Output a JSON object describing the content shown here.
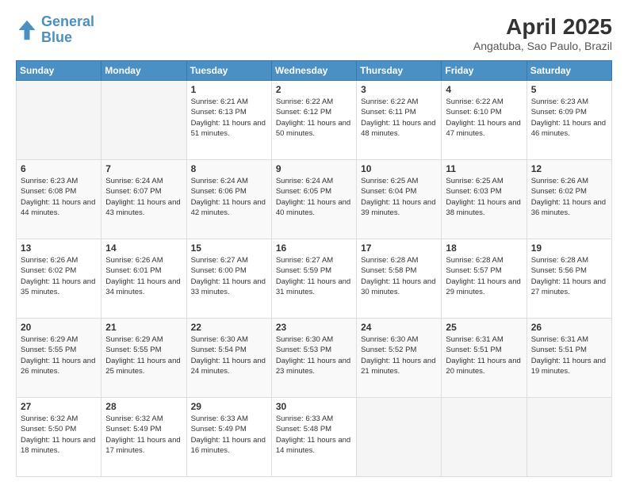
{
  "header": {
    "logo_line1": "General",
    "logo_line2": "Blue",
    "title": "April 2025",
    "subtitle": "Angatuba, Sao Paulo, Brazil"
  },
  "weekdays": [
    "Sunday",
    "Monday",
    "Tuesday",
    "Wednesday",
    "Thursday",
    "Friday",
    "Saturday"
  ],
  "weeks": [
    [
      {
        "day": "",
        "info": ""
      },
      {
        "day": "",
        "info": ""
      },
      {
        "day": "1",
        "info": "Sunrise: 6:21 AM\nSunset: 6:13 PM\nDaylight: 11 hours and 51 minutes."
      },
      {
        "day": "2",
        "info": "Sunrise: 6:22 AM\nSunset: 6:12 PM\nDaylight: 11 hours and 50 minutes."
      },
      {
        "day": "3",
        "info": "Sunrise: 6:22 AM\nSunset: 6:11 PM\nDaylight: 11 hours and 48 minutes."
      },
      {
        "day": "4",
        "info": "Sunrise: 6:22 AM\nSunset: 6:10 PM\nDaylight: 11 hours and 47 minutes."
      },
      {
        "day": "5",
        "info": "Sunrise: 6:23 AM\nSunset: 6:09 PM\nDaylight: 11 hours and 46 minutes."
      }
    ],
    [
      {
        "day": "6",
        "info": "Sunrise: 6:23 AM\nSunset: 6:08 PM\nDaylight: 11 hours and 44 minutes."
      },
      {
        "day": "7",
        "info": "Sunrise: 6:24 AM\nSunset: 6:07 PM\nDaylight: 11 hours and 43 minutes."
      },
      {
        "day": "8",
        "info": "Sunrise: 6:24 AM\nSunset: 6:06 PM\nDaylight: 11 hours and 42 minutes."
      },
      {
        "day": "9",
        "info": "Sunrise: 6:24 AM\nSunset: 6:05 PM\nDaylight: 11 hours and 40 minutes."
      },
      {
        "day": "10",
        "info": "Sunrise: 6:25 AM\nSunset: 6:04 PM\nDaylight: 11 hours and 39 minutes."
      },
      {
        "day": "11",
        "info": "Sunrise: 6:25 AM\nSunset: 6:03 PM\nDaylight: 11 hours and 38 minutes."
      },
      {
        "day": "12",
        "info": "Sunrise: 6:26 AM\nSunset: 6:02 PM\nDaylight: 11 hours and 36 minutes."
      }
    ],
    [
      {
        "day": "13",
        "info": "Sunrise: 6:26 AM\nSunset: 6:02 PM\nDaylight: 11 hours and 35 minutes."
      },
      {
        "day": "14",
        "info": "Sunrise: 6:26 AM\nSunset: 6:01 PM\nDaylight: 11 hours and 34 minutes."
      },
      {
        "day": "15",
        "info": "Sunrise: 6:27 AM\nSunset: 6:00 PM\nDaylight: 11 hours and 33 minutes."
      },
      {
        "day": "16",
        "info": "Sunrise: 6:27 AM\nSunset: 5:59 PM\nDaylight: 11 hours and 31 minutes."
      },
      {
        "day": "17",
        "info": "Sunrise: 6:28 AM\nSunset: 5:58 PM\nDaylight: 11 hours and 30 minutes."
      },
      {
        "day": "18",
        "info": "Sunrise: 6:28 AM\nSunset: 5:57 PM\nDaylight: 11 hours and 29 minutes."
      },
      {
        "day": "19",
        "info": "Sunrise: 6:28 AM\nSunset: 5:56 PM\nDaylight: 11 hours and 27 minutes."
      }
    ],
    [
      {
        "day": "20",
        "info": "Sunrise: 6:29 AM\nSunset: 5:55 PM\nDaylight: 11 hours and 26 minutes."
      },
      {
        "day": "21",
        "info": "Sunrise: 6:29 AM\nSunset: 5:55 PM\nDaylight: 11 hours and 25 minutes."
      },
      {
        "day": "22",
        "info": "Sunrise: 6:30 AM\nSunset: 5:54 PM\nDaylight: 11 hours and 24 minutes."
      },
      {
        "day": "23",
        "info": "Sunrise: 6:30 AM\nSunset: 5:53 PM\nDaylight: 11 hours and 23 minutes."
      },
      {
        "day": "24",
        "info": "Sunrise: 6:30 AM\nSunset: 5:52 PM\nDaylight: 11 hours and 21 minutes."
      },
      {
        "day": "25",
        "info": "Sunrise: 6:31 AM\nSunset: 5:51 PM\nDaylight: 11 hours and 20 minutes."
      },
      {
        "day": "26",
        "info": "Sunrise: 6:31 AM\nSunset: 5:51 PM\nDaylight: 11 hours and 19 minutes."
      }
    ],
    [
      {
        "day": "27",
        "info": "Sunrise: 6:32 AM\nSunset: 5:50 PM\nDaylight: 11 hours and 18 minutes."
      },
      {
        "day": "28",
        "info": "Sunrise: 6:32 AM\nSunset: 5:49 PM\nDaylight: 11 hours and 17 minutes."
      },
      {
        "day": "29",
        "info": "Sunrise: 6:33 AM\nSunset: 5:49 PM\nDaylight: 11 hours and 16 minutes."
      },
      {
        "day": "30",
        "info": "Sunrise: 6:33 AM\nSunset: 5:48 PM\nDaylight: 11 hours and 14 minutes."
      },
      {
        "day": "",
        "info": ""
      },
      {
        "day": "",
        "info": ""
      },
      {
        "day": "",
        "info": ""
      }
    ]
  ]
}
